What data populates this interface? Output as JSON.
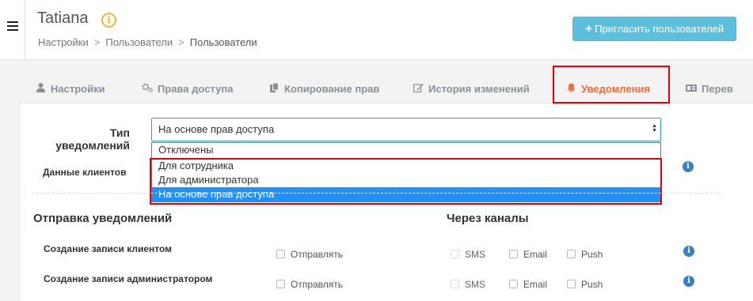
{
  "header": {
    "title": "Tatiana",
    "breadcrumb": [
      "Настройки",
      "Пользователи",
      "Пользователи"
    ],
    "invite_label": "Пригласить пользователей"
  },
  "tabs": [
    {
      "label": "Настройки",
      "icon": "user-icon"
    },
    {
      "label": "Права доступа",
      "icon": "cogs-icon"
    },
    {
      "label": "Копирование прав",
      "icon": "copy-icon"
    },
    {
      "label": "История изменений",
      "icon": "edit-icon"
    },
    {
      "label": "Уведомления",
      "icon": "bell-icon",
      "active": true
    },
    {
      "label": "Перев",
      "icon": "exchange-icon"
    }
  ],
  "form": {
    "type_label": "Тип уведомлений",
    "clients_label": "Данные клиентов",
    "select_value": "На основе прав доступа",
    "options": [
      "Отключены",
      "Для сотрудника",
      "Для администратора",
      "На основе прав доступа"
    ],
    "selected_option_index": 3
  },
  "sending": {
    "title": "Отправка уведомлений",
    "channels_title": "Через каналы",
    "rows": [
      {
        "label": "Создание записи клиентом",
        "send": "Отправлять",
        "channels": [
          "SMS",
          "Email",
          "Push"
        ]
      },
      {
        "label": "Создание записи администратором",
        "send": "Отправлять",
        "channels": [
          "SMS",
          "Email",
          "Push"
        ]
      }
    ]
  },
  "colors": {
    "accent": "#f26b3a",
    "invite_button": "#5bc0de",
    "highlight_border": "#e4000f",
    "selected_option": "#1e90ff",
    "info_icon": "#3b7fc4"
  }
}
